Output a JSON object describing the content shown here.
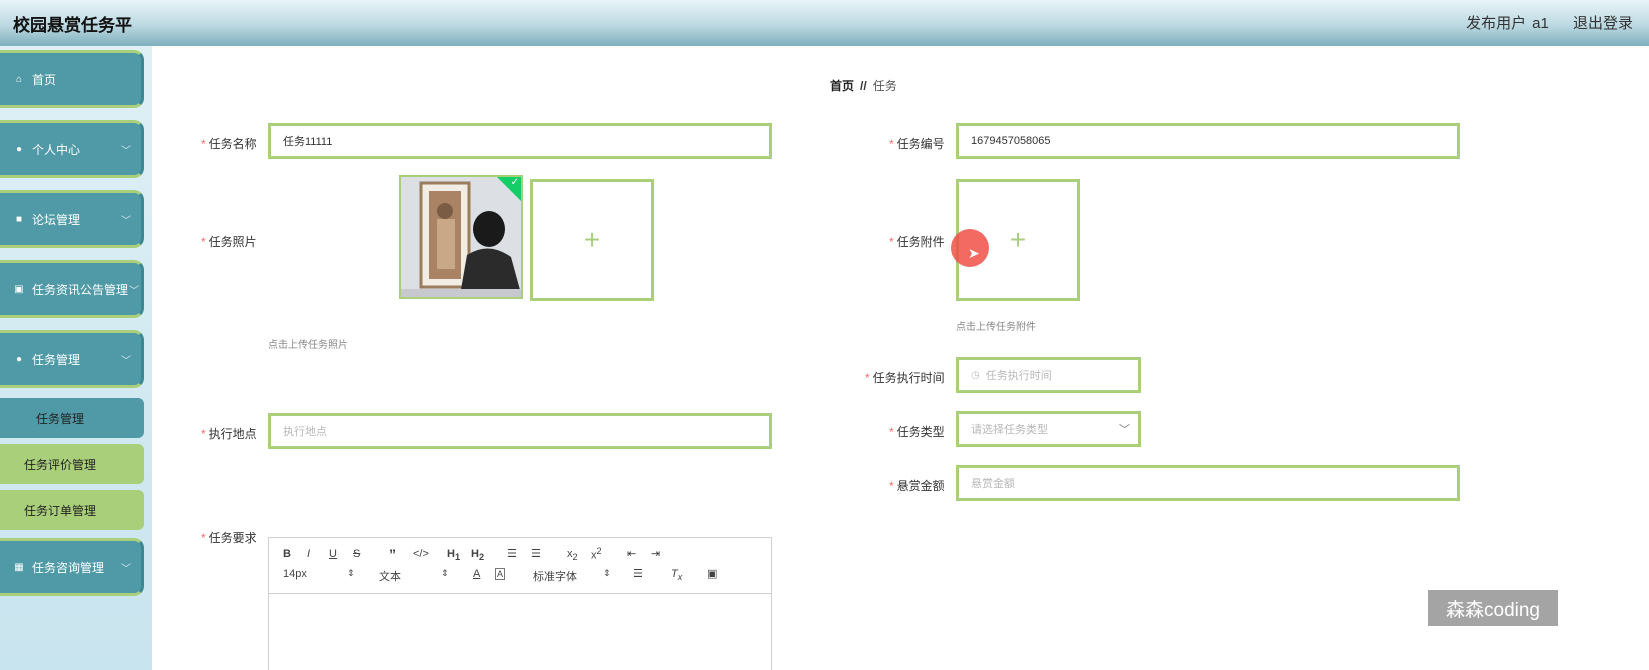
{
  "header": {
    "title": "校园悬赏任务平",
    "user_label": "发布用户",
    "user_name": "a1",
    "logout": "退出登录"
  },
  "sidebar": {
    "items": [
      {
        "label": "首页",
        "icon": "home-icon"
      },
      {
        "label": "个人中心",
        "icon": "user-icon"
      },
      {
        "label": "论坛管理",
        "icon": "forum-icon"
      },
      {
        "label": "任务资讯公告管理",
        "icon": "ticket-icon"
      },
      {
        "label": "任务管理",
        "icon": "user-icon"
      }
    ],
    "sub_items": [
      {
        "label": "任务管理",
        "active": true
      },
      {
        "label": "任务评价管理"
      },
      {
        "label": "任务订单管理"
      }
    ],
    "last_item": {
      "label": "任务咨询管理",
      "icon": "grid-icon"
    }
  },
  "breadcrumb": {
    "home": "首页",
    "separator": "//",
    "current": "任务"
  },
  "form": {
    "task_name": {
      "label": "任务名称",
      "value": "任务11111"
    },
    "task_number": {
      "label": "任务编号",
      "value": "1679457058065"
    },
    "task_photo": {
      "label": "任务照片",
      "hint": "点击上传任务照片"
    },
    "task_attachment": {
      "label": "任务附件",
      "hint": "点击上传任务附件"
    },
    "exec_time": {
      "label": "任务执行时间",
      "placeholder": "任务执行时间"
    },
    "location": {
      "label": "执行地点",
      "placeholder": "执行地点"
    },
    "task_type": {
      "label": "任务类型",
      "placeholder": "请选择任务类型"
    },
    "reward": {
      "label": "悬赏金额",
      "placeholder": "悬赏金额"
    },
    "requirement": {
      "label": "任务要求"
    }
  },
  "editor": {
    "font_size": "14px",
    "text_style": "文本",
    "font_family": "标准字体"
  },
  "watermark": "森森coding"
}
